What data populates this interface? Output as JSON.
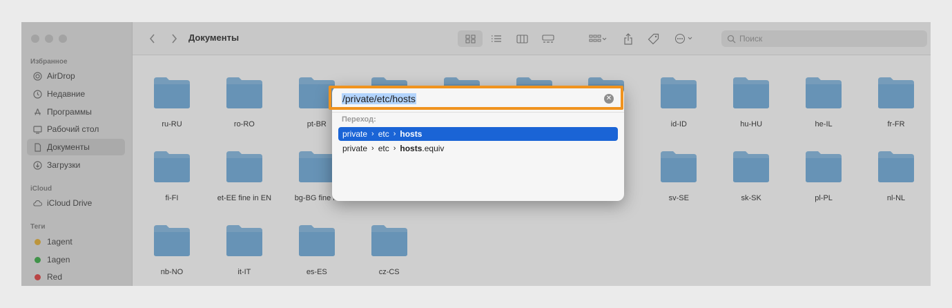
{
  "window": {
    "title": "Документы",
    "search_placeholder": "Поиск"
  },
  "sidebar": {
    "favorites_header": "Избранное",
    "favorites": [
      {
        "label": "AirDrop",
        "icon": "airdrop-icon"
      },
      {
        "label": "Недавние",
        "icon": "clock-icon"
      },
      {
        "label": "Программы",
        "icon": "apps-icon"
      },
      {
        "label": "Рабочий стол",
        "icon": "desktop-icon"
      },
      {
        "label": "Документы",
        "icon": "document-icon",
        "active": true
      },
      {
        "label": "Загрузки",
        "icon": "download-icon"
      }
    ],
    "icloud_header": "iCloud",
    "icloud": [
      {
        "label": "iCloud Drive",
        "icon": "cloud-icon"
      }
    ],
    "tags_header": "Теги",
    "tags": [
      {
        "label": "1agent",
        "color": "#e8b84a"
      },
      {
        "label": "1agen",
        "color": "#4fb55a"
      },
      {
        "label": "Red",
        "color": "#e45656"
      }
    ]
  },
  "folders": [
    "ru-RU",
    "ro-RO",
    "pt-BR",
    "",
    "",
    "",
    "",
    "id-ID",
    "hu-HU",
    "he-IL",
    "fr-FR",
    "fi-FI",
    "et-EE fine in EN",
    "bg-BG fine in",
    "",
    "",
    "",
    "",
    "sv-SE",
    "sk-SK",
    "pl-PL",
    "nl-NL",
    "nb-NO",
    "it-IT",
    "es-ES",
    "cz-CS"
  ],
  "goto": {
    "input_value": "/private/etc/hosts",
    "section_label": "Переход:",
    "suggestions": [
      {
        "p1": "private",
        "p2": "etc",
        "name": "hosts",
        "suffix": "",
        "selected": true
      },
      {
        "p1": "private",
        "p2": "etc",
        "name": "hosts",
        "suffix": ".equiv",
        "selected": false
      }
    ]
  },
  "colors": {
    "highlight_border": "#f0931e",
    "selection": "#1a64d6",
    "folder": "#7fb6e0"
  }
}
